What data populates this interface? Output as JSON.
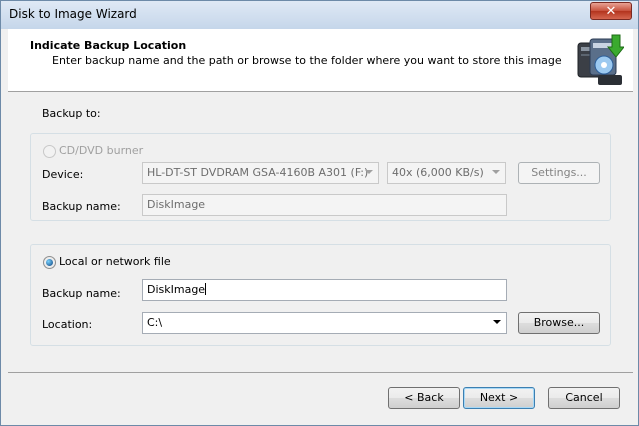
{
  "window": {
    "title": "Disk to Image Wizard",
    "close_label": "✕"
  },
  "header": {
    "title": "Indicate Backup Location",
    "subtitle": "Enter backup name and the path or browse to the folder where you want to store this image",
    "icon": "disk-backup-icon"
  },
  "backup_to_label": "Backup to:",
  "cd_group": {
    "option_label": "CD/DVD burner",
    "device_label": "Device:",
    "device_value": "HL-DT-ST DVDRAM GSA-4160B A301  (F:)",
    "speed_value": "40x (6,000 KB/s)",
    "settings_label": "Settings...",
    "name_label": "Backup name:",
    "name_value": "DiskImage"
  },
  "file_group": {
    "option_label": "Local or network file",
    "name_label": "Backup name:",
    "name_value": "DiskImage",
    "location_label": "Location:",
    "location_value": "C:\\",
    "browse_label": "Browse..."
  },
  "footer": {
    "back_label": "< Back",
    "next_label": "Next >",
    "cancel_label": "Cancel"
  }
}
